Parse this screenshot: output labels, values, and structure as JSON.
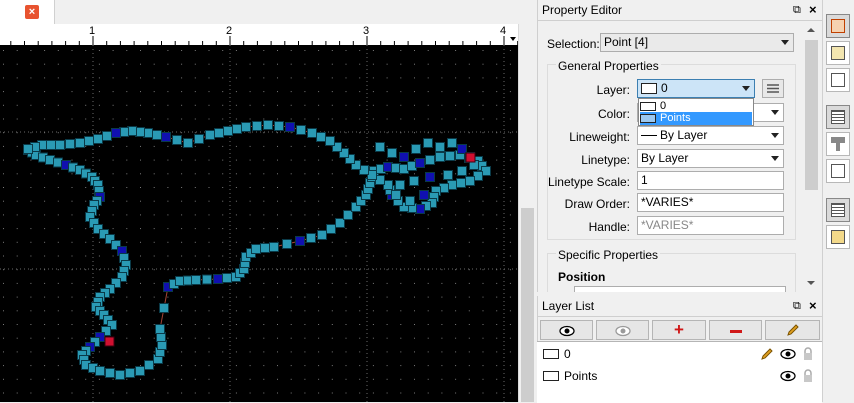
{
  "tabstrip": {
    "close_icon": "close-x-icon"
  },
  "ruler": {
    "labels": [
      "1",
      "2",
      "3",
      "4"
    ]
  },
  "canvas": {
    "background": "#000000",
    "point_color_cyan": "#2a9ab4",
    "point_color_blue": "#1010b0",
    "point_color_red": "#d01030",
    "track_color": "#c05040"
  },
  "property_editor": {
    "title": "Property Editor",
    "selection_label": "Selection:",
    "selection_value": "Point [4]",
    "general_title": "General Properties",
    "layer_label": "Layer:",
    "layer_value": "0",
    "layer_options": [
      "0",
      "Points"
    ],
    "color_label": "Color:",
    "lineweight_label": "Lineweight:",
    "lineweight_value": "By Layer",
    "linetype_label": "Linetype:",
    "linetype_value": "By Layer",
    "linetype_scale_label": "Linetype Scale:",
    "linetype_scale_value": "1",
    "draw_order_label": "Draw Order:",
    "draw_order_value": "*VARIES*",
    "handle_label": "Handle:",
    "handle_value": "*VARIES*",
    "specific_title": "Specific Properties",
    "position_title": "Position"
  },
  "layer_list": {
    "title": "Layer List",
    "layers": [
      {
        "name": "0"
      },
      {
        "name": "Points"
      }
    ],
    "add_color": "#d01818",
    "remove_color": "#d01818",
    "edit_color": "#d09a18"
  }
}
